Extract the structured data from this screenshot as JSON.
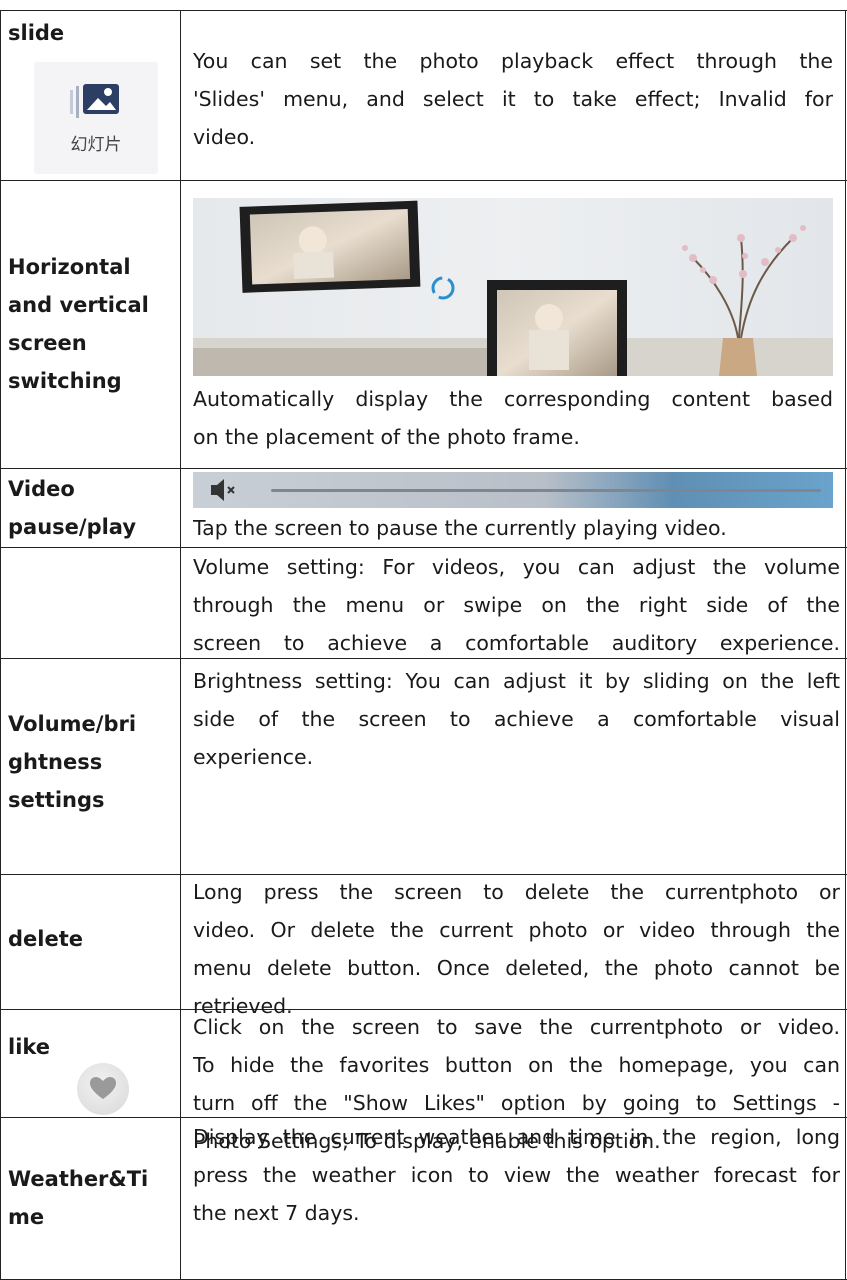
{
  "rows": [
    {
      "label": "slide",
      "icon": "slideshow-icon",
      "icon_caption": "幻灯片",
      "lines": [
        "You can set the photo playback effect through the",
        "'Slides' menu, and select it to take effect; Invalid for",
        "video."
      ]
    },
    {
      "label_lines": [
        "Horizontal",
        "and vertical",
        "screen",
        "switching"
      ],
      "image": "photo-frame-rotation-image",
      "lines": [
        "Automatically display the corresponding content based",
        "on the placement of the photo frame."
      ]
    },
    {
      "label_lines": [
        "Video",
        "pause/play"
      ],
      "image": "video-mute-progress-bar",
      "lines": [
        "Tap the screen to pause the currently playing video."
      ]
    },
    {
      "label_lines": [
        "Volume/bri",
        "ghtness",
        "settings"
      ],
      "lines": [
        "Volume setting: For videos, you can adjust the volume",
        "through the menu or swipe on the right side of the",
        "screen to achieve a comfortable auditory experience.",
        "Brightness setting: You can adjust it by sliding on the left",
        "side of the screen to achieve a comfortable visual",
        "experience."
      ]
    },
    {
      "label": "delete",
      "lines": [
        "Long press the screen to delete the currentphoto or",
        "video. Or delete the current photo or video through the",
        "menu delete button. Once deleted, the photo cannot be",
        "retrieved."
      ]
    },
    {
      "label": "like",
      "icon": "heart-icon",
      "lines": [
        "Click on the screen to save the currentphoto or video.",
        "To hide the favorites button on the homepage, you can",
        "turn off the \"Show Likes\" option by going to Settings -",
        "Photo Settings; To display, enable this option."
      ]
    },
    {
      "label_lines": [
        "Weather&Ti",
        "me"
      ],
      "lines": [
        "Display the current weather and time in the region, long",
        "press the weather icon to view the weather forecast for",
        "the next 7 days."
      ]
    }
  ]
}
